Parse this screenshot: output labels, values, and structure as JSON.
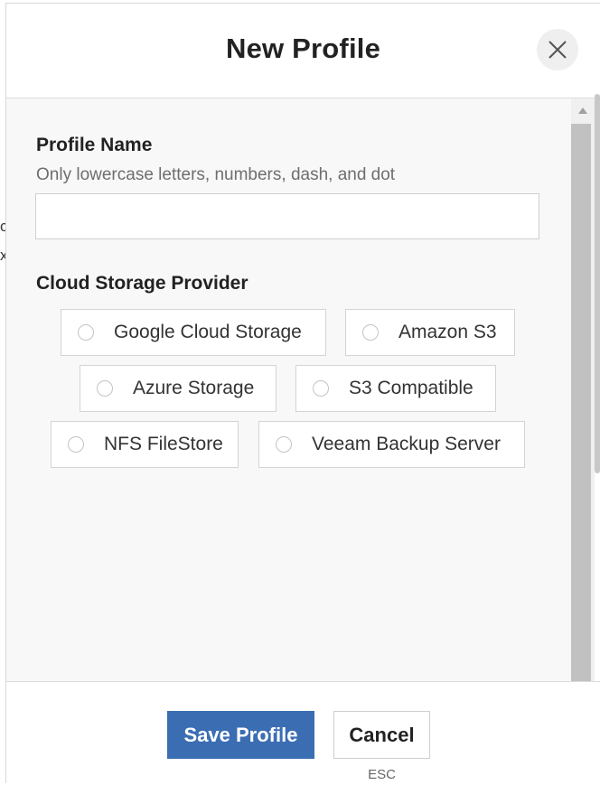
{
  "modal": {
    "title": "New Profile"
  },
  "form": {
    "profile_name": {
      "label": "Profile Name",
      "hint": "Only lowercase letters, numbers, dash, and dot",
      "value": "",
      "placeholder": ""
    },
    "provider": {
      "label": "Cloud Storage Provider",
      "options": [
        {
          "label": "Google Cloud Storage",
          "selected": false
        },
        {
          "label": "Amazon S3",
          "selected": false
        },
        {
          "label": "Azure Storage",
          "selected": false
        },
        {
          "label": "S3 Compatible",
          "selected": false
        },
        {
          "label": "NFS FileStore",
          "selected": false
        },
        {
          "label": "Veeam Backup Server",
          "selected": false
        }
      ]
    }
  },
  "footer": {
    "save_label": "Save Profile",
    "cancel_label": "Cancel",
    "cancel_shortcut": "ESC"
  },
  "backdrop": {
    "fragments": [
      "c",
      "x"
    ]
  },
  "colors": {
    "primary": "#3b6db3",
    "body_bg": "#f8f8f8",
    "title_text": "#222222",
    "hint_text": "#6e6e6e"
  }
}
